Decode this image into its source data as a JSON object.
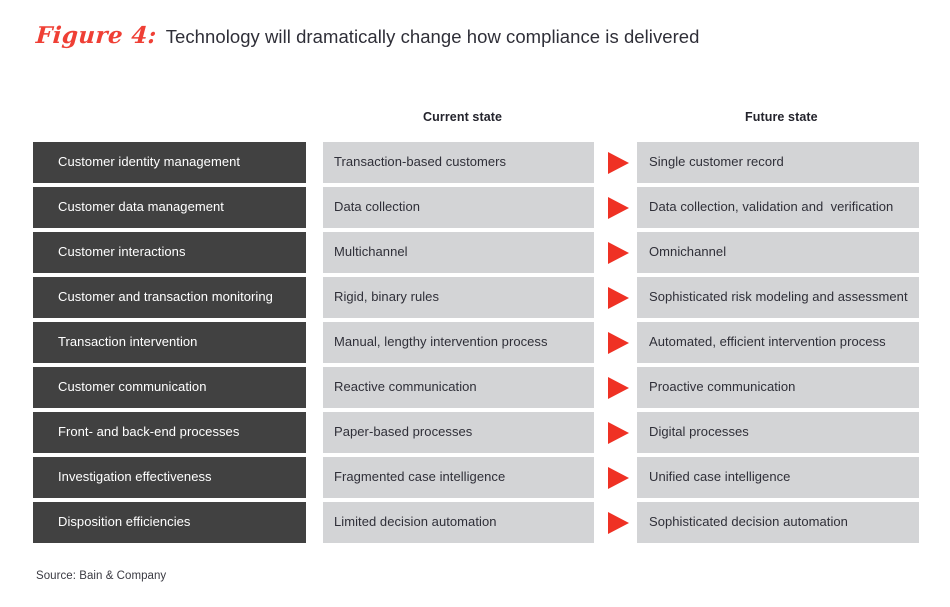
{
  "header": {
    "figure_label": "Figure 4:",
    "title": "Technology will dramatically change how compliance is delivered"
  },
  "columns": {
    "category_header": "",
    "current_header": "Current state",
    "future_header": "Future state"
  },
  "colors": {
    "accent_red": "#ef3124",
    "title_red": "#ef3f35",
    "dark_cell": "#414141",
    "light_cell": "#d3d4d6",
    "text_dark": "#2f2f38",
    "text_light": "#ffffff"
  },
  "arrow_icon": "right-triangle-arrow-icon",
  "rows": [
    {
      "category": "Customer identity management",
      "current": "Transaction-based customers",
      "future": "Single customer record"
    },
    {
      "category": "Customer data management",
      "current": "Data collection",
      "future": "Data collection, validation and  verification"
    },
    {
      "category": "Customer interactions",
      "current": "Multichannel",
      "future": "Omnichannel"
    },
    {
      "category": "Customer and transaction monitoring",
      "current": "Rigid, binary rules",
      "future": "Sophisticated risk modeling and assessment"
    },
    {
      "category": "Transaction intervention",
      "current": "Manual, lengthy intervention process",
      "future": "Automated, efficient intervention process"
    },
    {
      "category": "Customer communication",
      "current": "Reactive communication",
      "future": "Proactive communication"
    },
    {
      "category": "Front- and back-end processes",
      "current": "Paper-based processes",
      "future": "Digital processes"
    },
    {
      "category": "Investigation effectiveness",
      "current": "Fragmented case intelligence",
      "future": "Unified case intelligence"
    },
    {
      "category": "Disposition efficiencies",
      "current": "Limited decision automation",
      "future": "Sophisticated decision automation"
    }
  ],
  "footer": {
    "source": "Source: Bain & Company"
  }
}
